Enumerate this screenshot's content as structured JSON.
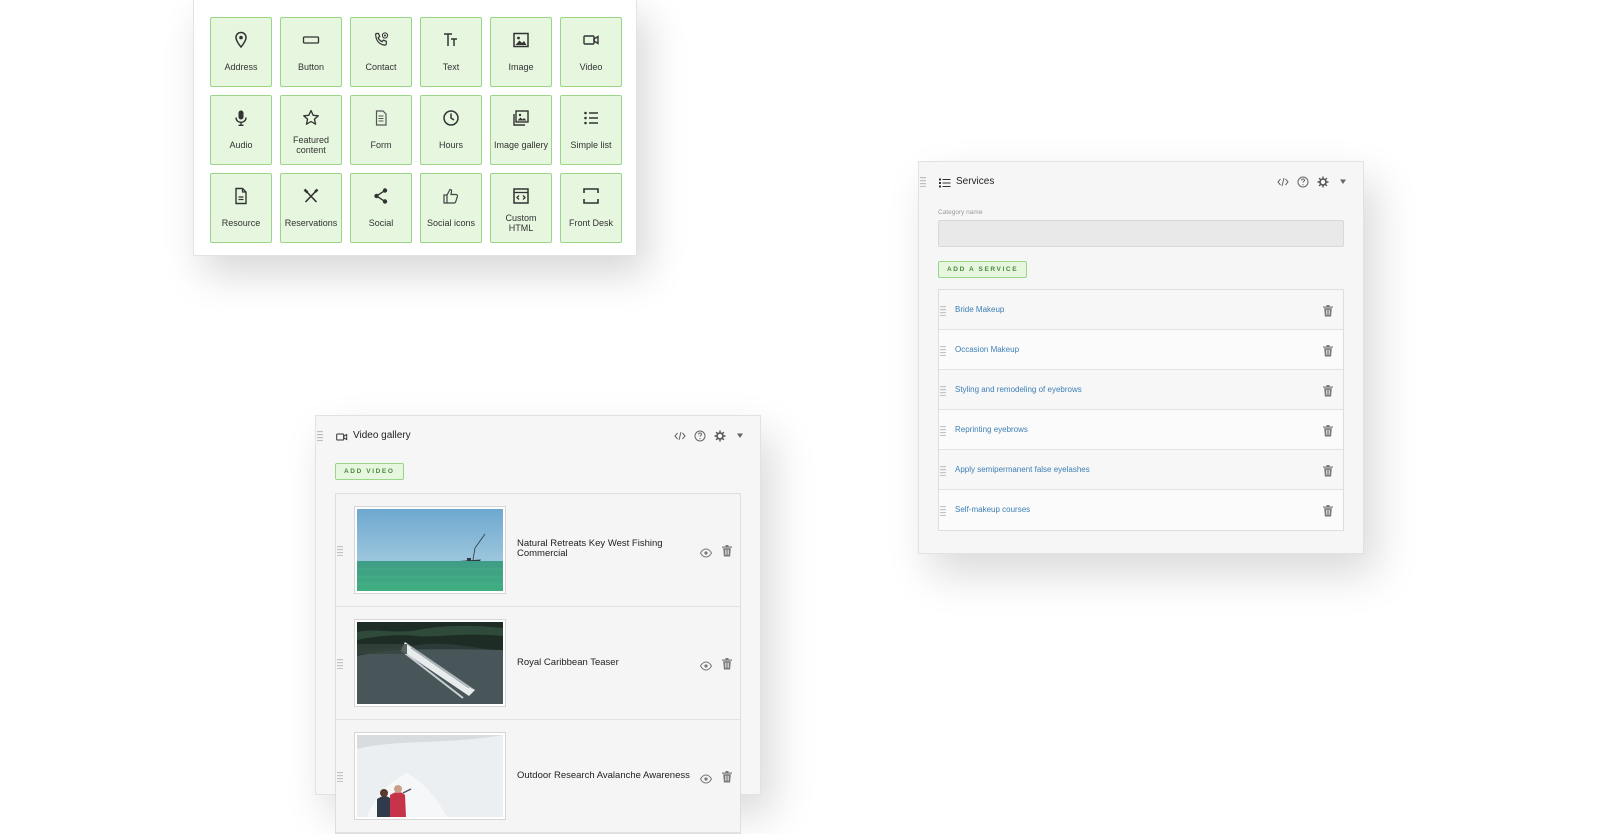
{
  "picker": {
    "tiles": [
      {
        "label": "Address",
        "icon": "map-pin-icon"
      },
      {
        "label": "Button",
        "icon": "button-icon"
      },
      {
        "label": "Contact",
        "icon": "phone-icon"
      },
      {
        "label": "Text",
        "icon": "text-icon"
      },
      {
        "label": "Image",
        "icon": "image-icon"
      },
      {
        "label": "Video",
        "icon": "video-icon"
      },
      {
        "label": "Audio",
        "icon": "microphone-icon"
      },
      {
        "label": "Featured content",
        "icon": "star-icon"
      },
      {
        "label": "Form",
        "icon": "form-icon"
      },
      {
        "label": "Hours",
        "icon": "clock-icon"
      },
      {
        "label": "Image gallery",
        "icon": "image-gallery-icon"
      },
      {
        "label": "Simple list",
        "icon": "list-icon"
      },
      {
        "label": "Resource",
        "icon": "document-icon"
      },
      {
        "label": "Reservations",
        "icon": "utensils-icon"
      },
      {
        "label": "Social",
        "icon": "share-icon"
      },
      {
        "label": "Social icons",
        "icon": "thumbs-up-icon"
      },
      {
        "label": "Custom HTML",
        "icon": "code-icon"
      },
      {
        "label": "Front Desk",
        "icon": "frame-icon"
      }
    ]
  },
  "services": {
    "title": "Services",
    "category_label": "Category name",
    "category_value": "",
    "add_label": "ADD A SERVICE",
    "items": [
      "Bride Makeup",
      "Occasion Makeup",
      "Styling and remodeling of eyebrows",
      "Reprinting eyebrows",
      "Apply semipermanent false eyelashes",
      "Self-makeup courses"
    ]
  },
  "video_gallery": {
    "title": "Video gallery",
    "add_label": "ADD VIDEO",
    "videos": [
      {
        "title": "Natural Retreats Key West Fishing Commercial"
      },
      {
        "title": "Royal Caribbean Teaser"
      },
      {
        "title": "Outdoor Research Avalanche Awareness"
      }
    ]
  },
  "colors": {
    "accent_green": "#9ad58a",
    "tile_bg": "#e6f6df",
    "link_blue": "#3d7fb5"
  }
}
